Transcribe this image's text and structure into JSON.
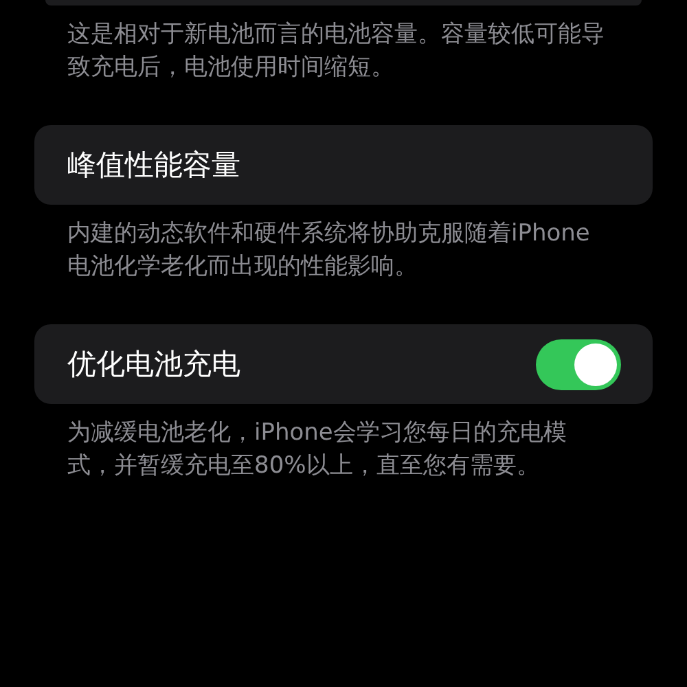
{
  "sections": [
    {
      "kind": "footer-only",
      "footer": "这是相对于新电池而言的电池容量。容量较低可能导致充电后，电池使用时间缩短。"
    },
    {
      "kind": "row",
      "title": "峰值性能容量",
      "footer": "内建的动态软件和硬件系统将协助克服随着iPhone电池化学老化而出现的性能影响。"
    },
    {
      "kind": "toggle",
      "title": "优化电池充电",
      "on": true,
      "footer": "为减缓电池老化，iPhone会学习您每日的充电模式，并暂缓充电至80%以上，直至您有需要。"
    }
  ]
}
